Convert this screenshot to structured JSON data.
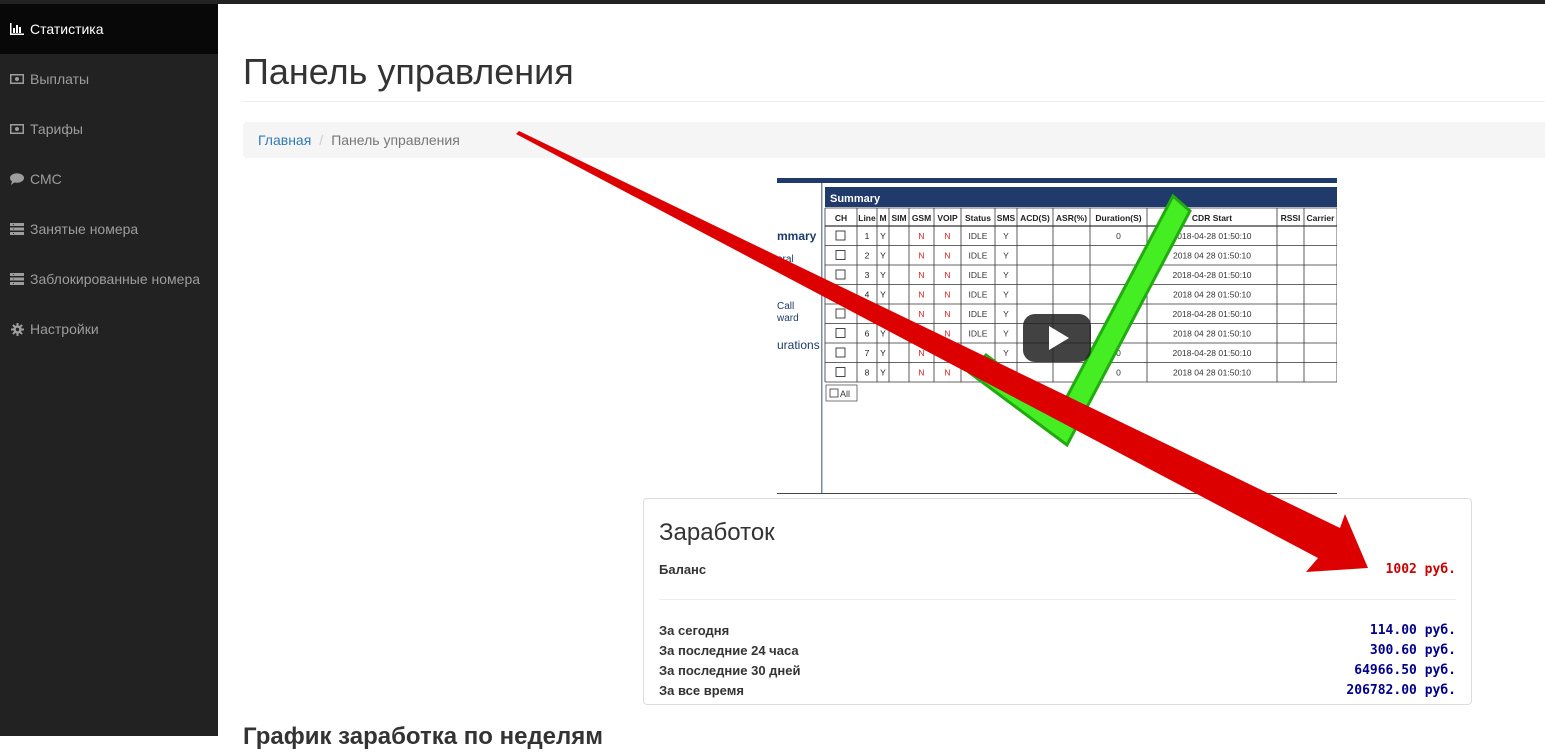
{
  "sidebar": {
    "items": [
      {
        "label": "Статистика",
        "icon": "bar-chart-icon",
        "active": true
      },
      {
        "label": "Выплаты",
        "icon": "money-icon"
      },
      {
        "label": "Тарифы",
        "icon": "money-icon"
      },
      {
        "label": "СМС",
        "icon": "comment-icon"
      },
      {
        "label": "Занятые номера",
        "icon": "list-icon"
      },
      {
        "label": "Заблокированные номера",
        "icon": "list-icon"
      },
      {
        "label": "Настройки",
        "icon": "gear-icon"
      }
    ]
  },
  "header": {
    "title": "Панель управления"
  },
  "breadcrumb": {
    "home": "Главная",
    "current": "Панель управления"
  },
  "video": {
    "summary_title": "Summary",
    "side_labels": [
      "mmary",
      "eral",
      "Call",
      "ward",
      "urations"
    ],
    "columns": [
      "CH",
      "Line",
      "M",
      "SIM",
      "GSM",
      "VOIP",
      "Status",
      "SMS",
      "ACD(S)",
      "ASR(%)",
      "Duration(S)",
      "CDR Start",
      "RSSI",
      "Carrier"
    ],
    "rows": [
      {
        "line": "1",
        "m": "Y",
        "gsm": "N",
        "voip": "N",
        "status": "IDLE",
        "sms": "Y",
        "duration": "0",
        "cdr": "2018-04-28 01:50:10"
      },
      {
        "line": "2",
        "m": "Y",
        "gsm": "N",
        "voip": "N",
        "status": "IDLE",
        "sms": "Y",
        "duration": "",
        "cdr": "2018 04 28 01:50:10"
      },
      {
        "line": "3",
        "m": "Y",
        "gsm": "N",
        "voip": "N",
        "status": "IDLE",
        "sms": "Y",
        "duration": "",
        "cdr": "2018-04-28 01:50:10"
      },
      {
        "line": "4",
        "m": "Y",
        "gsm": "N",
        "voip": "N",
        "status": "IDLE",
        "sms": "Y",
        "duration": "",
        "cdr": "2018 04 28 01:50:10"
      },
      {
        "line": "",
        "m": "",
        "gsm": "N",
        "voip": "N",
        "status": "IDLE",
        "sms": "Y",
        "duration": "0",
        "cdr": "2018-04-28 01:50:10"
      },
      {
        "line": "6",
        "m": "Y",
        "gsm": "N",
        "voip": "N",
        "status": "IDLE",
        "sms": "Y",
        "duration": "0",
        "cdr": "2018 04 28 01:50:10"
      },
      {
        "line": "7",
        "m": "Y",
        "gsm": "N",
        "voip": "",
        "status": "",
        "sms": "Y",
        "duration": "0",
        "cdr": "2018-04-28 01:50:10"
      },
      {
        "line": "8",
        "m": "Y",
        "gsm": "N",
        "voip": "N",
        "status": "",
        "sms": "",
        "duration": "0",
        "cdr": "2018 04 28 01:50:10"
      }
    ],
    "all_label": "All"
  },
  "earnings": {
    "title": "Заработок",
    "balance_label": "Баланс",
    "balance_value": "1002 руб.",
    "stats": [
      {
        "label": "За сегодня",
        "value": "114.00 руб."
      },
      {
        "label": "За последние 24 часа",
        "value": "300.60 руб."
      },
      {
        "label": "За последние 30 дней",
        "value": "64966.50 руб."
      },
      {
        "label": "За все время",
        "value": "206782.00 руб."
      }
    ]
  },
  "chart_section": {
    "title": "График заработка по неделям"
  },
  "colors": {
    "sidebar_bg": "#222222",
    "active_bg": "#080808",
    "link": "#337ab7",
    "balance": "#cc0000",
    "stat_value": "#00008b",
    "arrow": "#dd0000",
    "check": "#33ee11"
  }
}
